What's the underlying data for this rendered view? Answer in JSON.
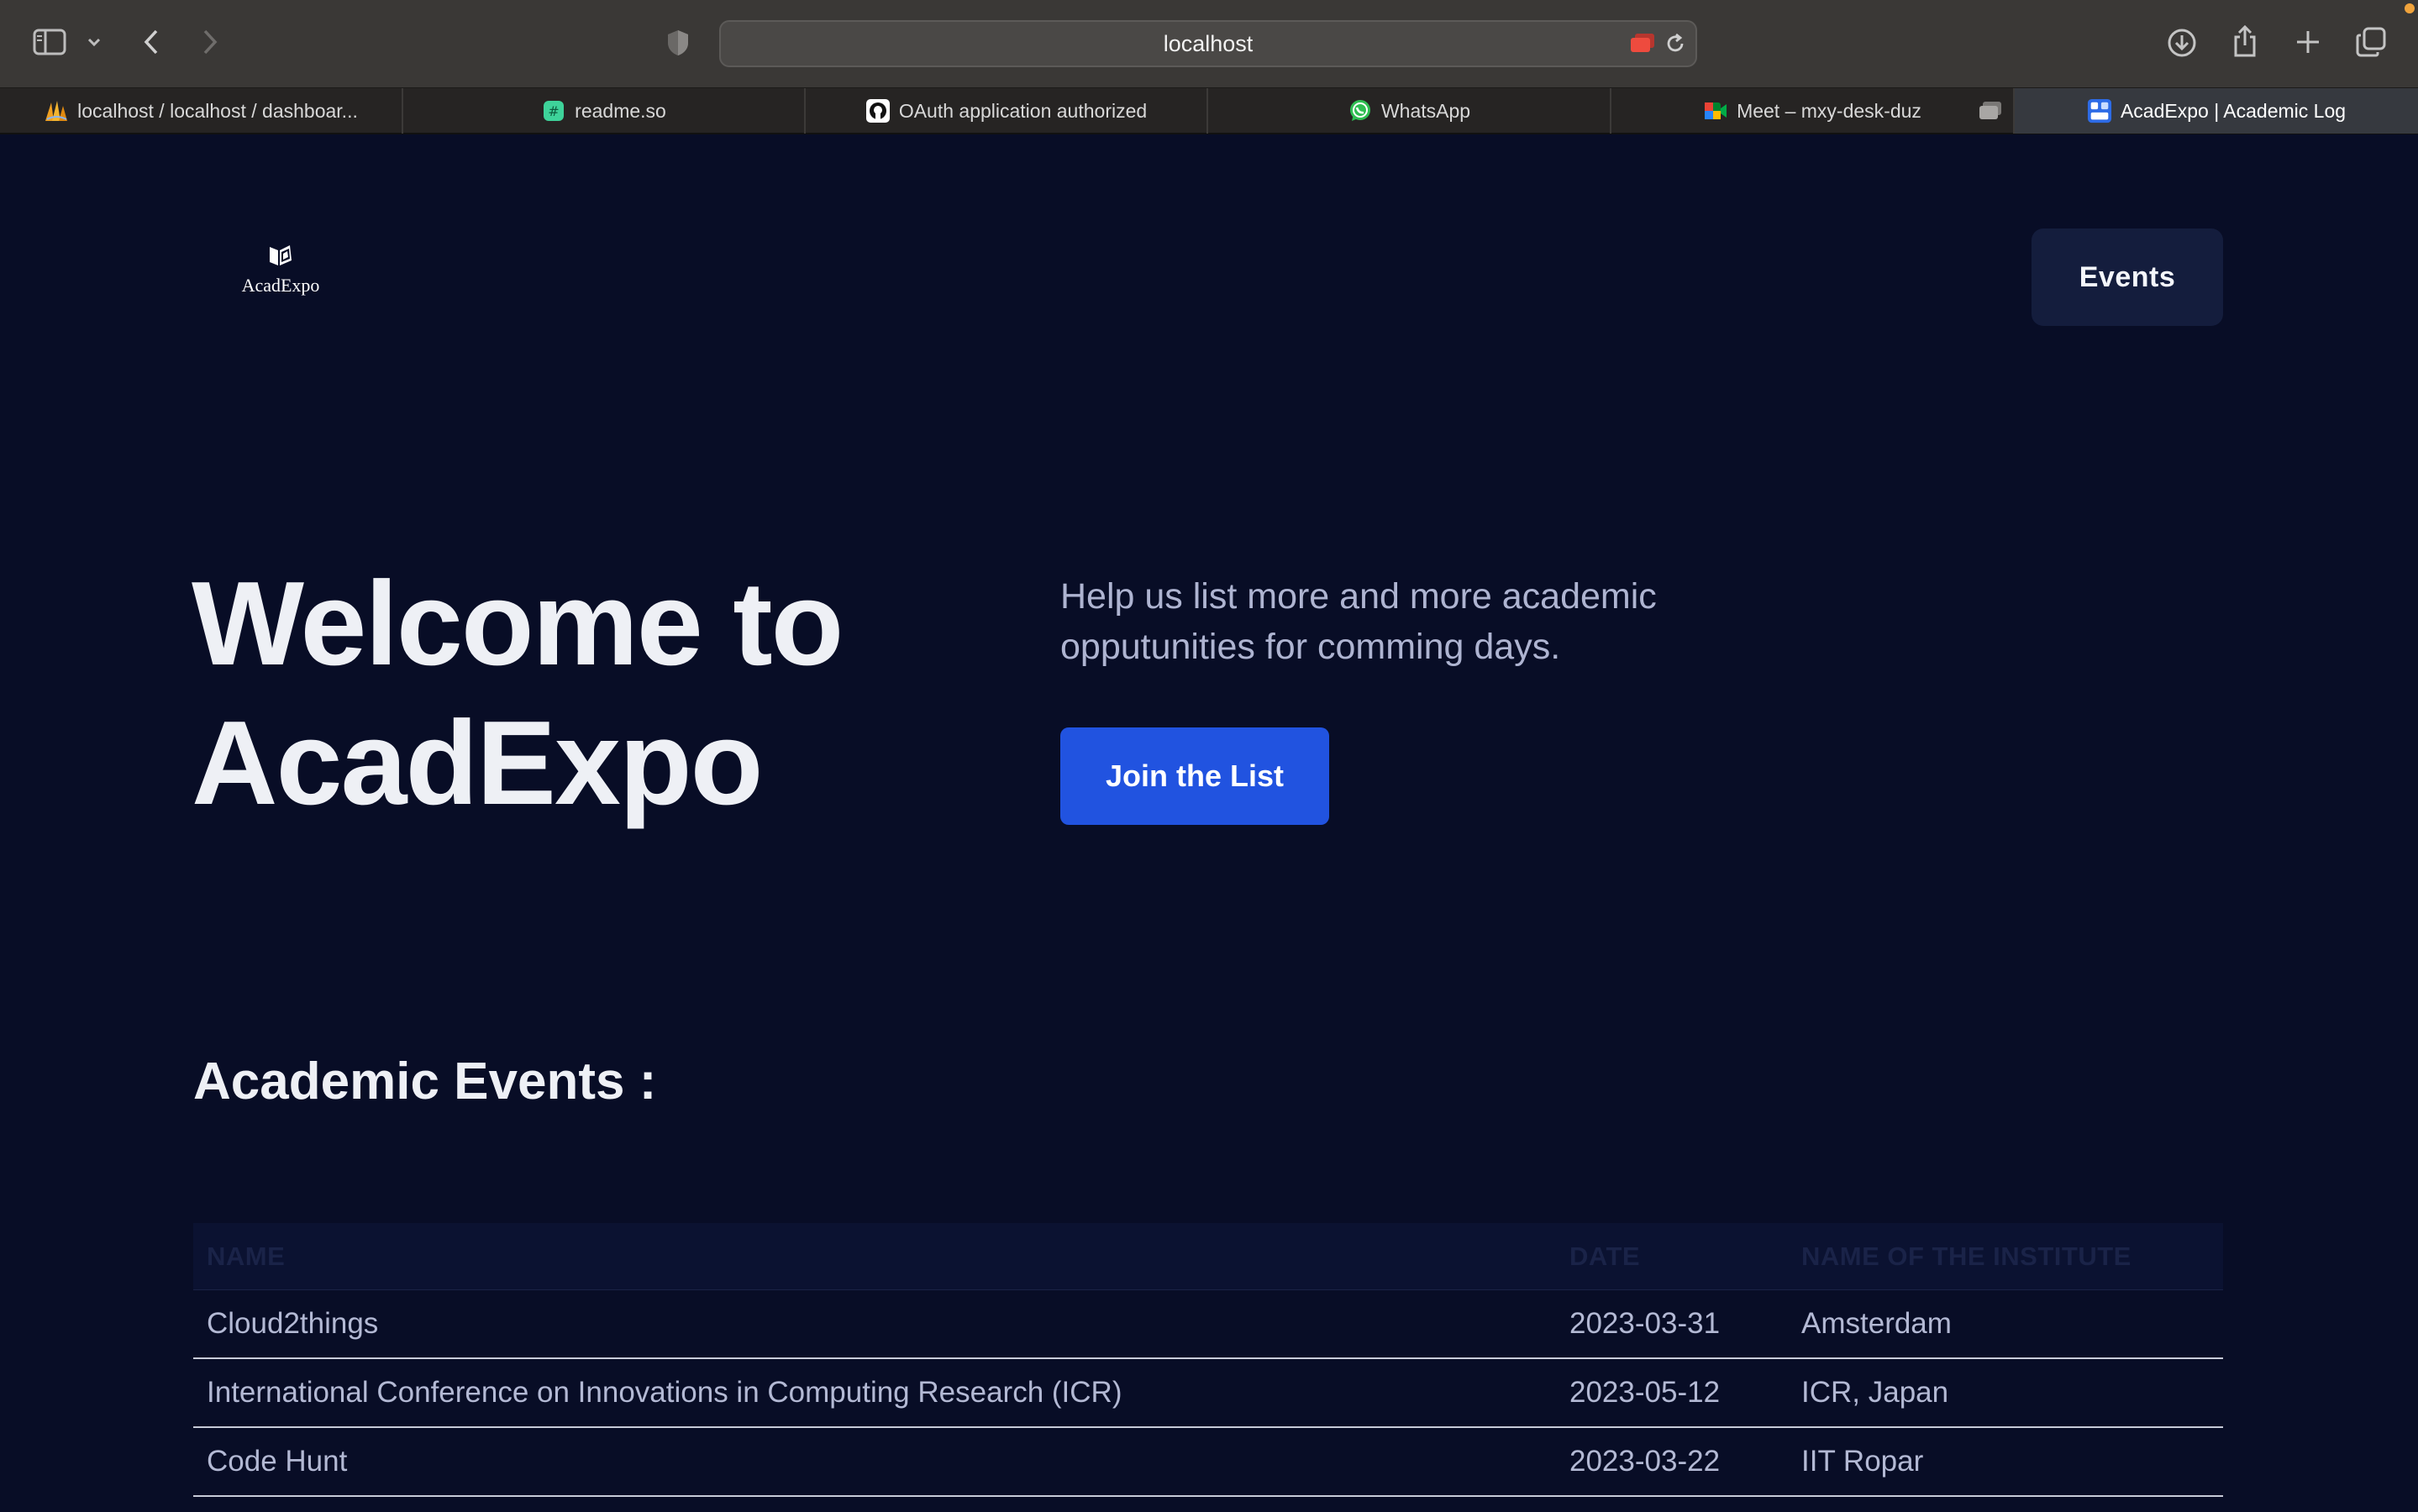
{
  "browser": {
    "url": "localhost",
    "tabs": [
      {
        "label": "localhost / localhost / dashboar...",
        "icon": "phpmyadmin-icon",
        "active": false
      },
      {
        "label": "readme.so",
        "icon": "readme-icon",
        "active": false
      },
      {
        "label": "OAuth application authorized",
        "icon": "github-icon",
        "active": false
      },
      {
        "label": "WhatsApp",
        "icon": "whatsapp-icon",
        "active": false
      },
      {
        "label": "Meet – mxy-desk-duz",
        "icon": "google-meet-icon",
        "active": false
      },
      {
        "label": "AcadExpo | Academic Log",
        "icon": "acadexpo-favicon-icon",
        "active": true
      }
    ]
  },
  "nav": {
    "logo_text": "AcadExpo",
    "events_label": "Events"
  },
  "hero": {
    "title_line1": "Welcome to",
    "title_line2": "AcadExpo",
    "subtitle": "Help us list more and more academic opputunities for comming days.",
    "cta_label": "Join the List"
  },
  "events": {
    "section_title": "Academic Events :",
    "columns": [
      "NAME",
      "DATE",
      "NAME OF THE INSTITUTE"
    ],
    "rows": [
      {
        "name": "Cloud2things",
        "date": "2023-03-31",
        "institute": "Amsterdam"
      },
      {
        "name": "International Conference on Innovations in Computing Research (ICR)",
        "date": "2023-05-12",
        "institute": "ICR, Japan"
      },
      {
        "name": "Code Hunt",
        "date": "2023-03-22",
        "institute": "IIT Ropar"
      }
    ]
  },
  "colors": {
    "page_bg": "#080d26",
    "primary_button": "#2153e0",
    "events_button": "#141d3d",
    "chrome_bg": "#3a3836"
  }
}
